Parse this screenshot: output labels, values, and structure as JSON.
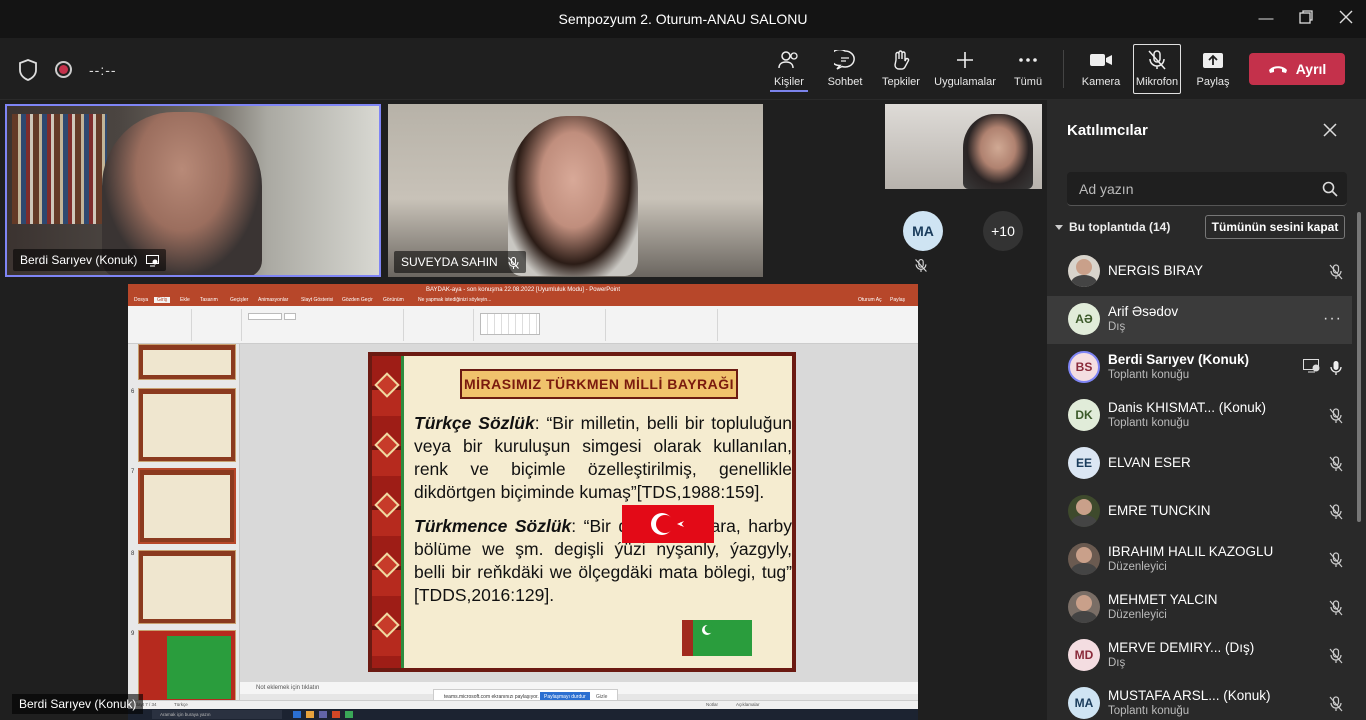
{
  "window": {
    "title": "Sempozyum 2. Oturum-ANAU SALONU"
  },
  "toolbar": {
    "timer": "--:--",
    "people_label": "Kişiler",
    "chat_label": "Sohbet",
    "reactions_label": "Tepkiler",
    "apps_label": "Uygulamalar",
    "more_label": "Tümü",
    "camera_label": "Kamera",
    "mic_label": "Mikrofon",
    "share_label": "Paylaş",
    "leave_label": "Ayrıl",
    "leave_color": "#c4314b",
    "accent_color": "#7b83eb"
  },
  "videos": [
    {
      "name": "Berdi Sarıyev (Konuk)"
    },
    {
      "name": "SUVEYDA SAHIN"
    }
  ],
  "gallery": {
    "avatar_initials": "MA",
    "overflow_count": "+10"
  },
  "shared_screen": {
    "presenter_label": "Berdi Sarıyev (Konuk)",
    "ppt_title": "BAYDAK-aya - son konuşma 22.08.2022 [Uyumluluk Modu] - PowerPoint",
    "tabs": [
      "Dosya",
      "Giriş",
      "Ekle",
      "Tasarım",
      "Geçişler",
      "Animasyonlar",
      "Slayt Gösterisi",
      "Gözden Geçir",
      "Görünüm",
      "Ne yapmak istediğinizi söyleyin..."
    ],
    "user_label": "Oturum Aç",
    "share_tab": "Paylaş",
    "notes_placeholder": "Not eklemek için tıklatın",
    "sharing_banner": "teams.microsoft.com ekranınızı paylaşıyor.",
    "stop_sharing": "Paylaşmayı durdur",
    "hide": "Gizle",
    "status_slide": "Slayt 7 / 34",
    "status_lang": "Türkçe",
    "status_notes": "Notlar",
    "status_comments": "Açıklamalar",
    "taskbar_search": "Aramak için buraya yazın",
    "thumb_numbers": [
      "6",
      "7",
      "8",
      "9"
    ],
    "slide": {
      "title": "MİRASIMIZ TÜRKMEN MİLLİ BAYRAĞI",
      "p1_term": "Türkçe Sözlük",
      "p1_text": ": “Bir milletin, belli bir topluluğun veya bir kuruluşun simgesi olarak kullanılan, renk ve biçimle özelleştirilmiş, genellikle dikdörtgen biçiminde kumaş”[TDS,1988:159].",
      "p2_term": "Türkmence Sözlük",
      "p2_text": ": “Bir döwlete, edara, harby bölüme we şm. degişli ýüzi nyşanly, ýazgyly, belli bir reňkdäki we ölçegdäki mata bölegi, tug” [TDDS,2016:129]."
    }
  },
  "participants_panel": {
    "title": "Katılımcılar",
    "search_placeholder": "Ad yazın",
    "section_label": "Bu toplantıda (14)",
    "mute_all": "Tümünün sesini kapat",
    "people": [
      {
        "name": "NERGIS BIRAY",
        "role": "",
        "initials": "",
        "avatar_color": "#d8d4cc"
      },
      {
        "name": "Arif Əsədov",
        "role": "Dış",
        "initials": "AƏ",
        "avatar_color": "#e1ecd9"
      },
      {
        "name": "Berdi Sarıyev (Konuk)",
        "role": "Toplantı konuğu",
        "initials": "BS",
        "avatar_color": "#f4dde1"
      },
      {
        "name": "Danis KHISMAT...   (Konuk)",
        "role": "Toplantı konuğu",
        "initials": "DK",
        "avatar_color": "#e1ecd9"
      },
      {
        "name": "ELVAN ESER",
        "role": "",
        "initials": "EE",
        "avatar_color": "#dbe6f3"
      },
      {
        "name": "EMRE TUNCKIN",
        "role": "",
        "initials": "",
        "avatar_color": "#3e4a2c"
      },
      {
        "name": "IBRAHIM HALIL KAZOGLU",
        "role": "Düzenleyici",
        "initials": "",
        "avatar_color": "#6a5a50"
      },
      {
        "name": "MEHMET YALCIN",
        "role": "Düzenleyici",
        "initials": "",
        "avatar_color": "#7a6e66"
      },
      {
        "name": "MERVE DEMIRY...   (Dış)",
        "role": "Dış",
        "initials": "MD",
        "avatar_color": "#f4dde1"
      },
      {
        "name": "MUSTAFA ARSL...   (Konuk)",
        "role": "Toplantı konuğu",
        "initials": "MA",
        "avatar_color": "#cfe4f3"
      }
    ]
  }
}
